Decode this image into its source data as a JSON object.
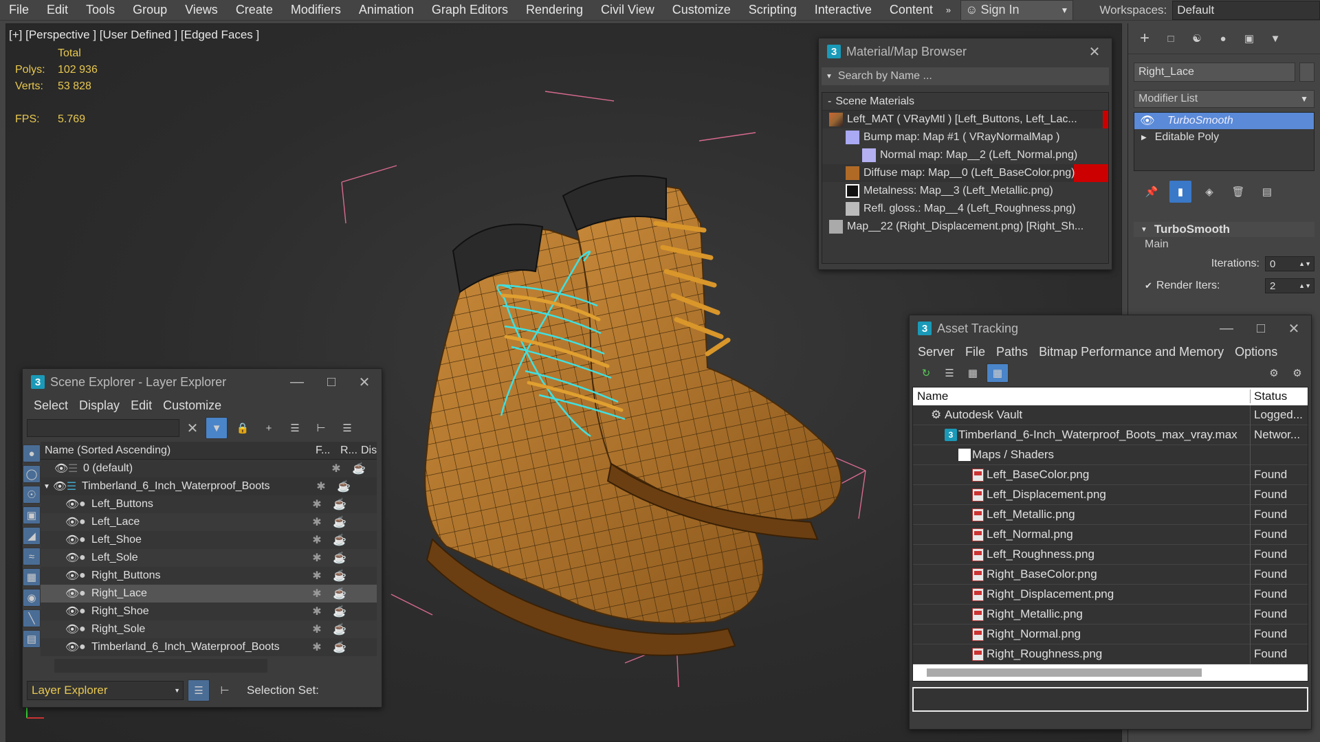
{
  "menu": [
    "File",
    "Edit",
    "Tools",
    "Group",
    "Views",
    "Create",
    "Modifiers",
    "Animation",
    "Graph Editors",
    "Rendering",
    "Civil View",
    "Customize",
    "Scripting",
    "Interactive",
    "Content"
  ],
  "signin": "Sign In",
  "workspaces_label": "Workspaces:",
  "workspace_value": "Default",
  "viewport": {
    "label": "[+] [Perspective ] [User Defined ] [Edged Faces ]",
    "total": "Total",
    "polys_label": "Polys:",
    "polys": "102 936",
    "verts_label": "Verts:",
    "verts": "53 828",
    "fps_label": "FPS:",
    "fps": "5.769"
  },
  "material_browser": {
    "title": "Material/Map Browser",
    "search_placeholder": "Search by Name ...",
    "section": "Scene Materials",
    "items": [
      "Left_MAT  ( VRayMtl )  [Left_Buttons, Left_Lac...",
      "Bump map: Map #1  ( VRayNormalMap )",
      "Normal map: Map__2 (Left_Normal.png)",
      "Diffuse map: Map__0 (Left_BaseColor.png)",
      "Metalness: Map__3 (Left_Metallic.png)",
      "Refl. gloss.: Map__4 (Left_Roughness.png)",
      "Map__22 (Right_Displacement.png)  [Right_Sh..."
    ]
  },
  "command_panel": {
    "object_name": "Right_Lace",
    "modifier_list": "Modifier List",
    "stack": [
      "TurboSmooth",
      "Editable Poly"
    ],
    "rollout": "TurboSmooth",
    "group": "Main",
    "iterations_label": "Iterations:",
    "iterations": "0",
    "render_iters_label": "Render Iters:",
    "render_iters": "2"
  },
  "scene_explorer": {
    "title": "Scene Explorer - Layer Explorer",
    "menu": [
      "Select",
      "Display",
      "Edit",
      "Customize"
    ],
    "col_name": "Name (Sorted Ascending)",
    "col_f": "F...",
    "col_r": "R...",
    "col_d": "Dis",
    "rows": [
      {
        "name": "0 (default)",
        "indent": 0
      },
      {
        "name": "Timberland_6_Inch_Waterproof_Boots",
        "indent": 0
      },
      {
        "name": "Left_Buttons",
        "indent": 1
      },
      {
        "name": "Left_Lace",
        "indent": 1
      },
      {
        "name": "Left_Shoe",
        "indent": 1
      },
      {
        "name": "Left_Sole",
        "indent": 1
      },
      {
        "name": "Right_Buttons",
        "indent": 1
      },
      {
        "name": "Right_Lace",
        "indent": 1
      },
      {
        "name": "Right_Shoe",
        "indent": 1
      },
      {
        "name": "Right_Sole",
        "indent": 1
      },
      {
        "name": "Timberland_6_Inch_Waterproof_Boots",
        "indent": 1
      }
    ],
    "footer_explorer": "Layer Explorer",
    "selection_set": "Selection Set:"
  },
  "asset_tracking": {
    "title": "Asset Tracking",
    "menu": [
      "Server",
      "File",
      "Paths",
      "Bitmap Performance and Memory",
      "Options"
    ],
    "col_name": "Name",
    "col_status": "Status",
    "rows": [
      {
        "name": "Autodesk Vault",
        "status": "Logged..."
      },
      {
        "name": "Timberland_6-Inch_Waterproof_Boots_max_vray.max",
        "status": "Networ..."
      },
      {
        "name": "Maps / Shaders",
        "status": ""
      },
      {
        "name": "Left_BaseColor.png",
        "status": "Found"
      },
      {
        "name": "Left_Displacement.png",
        "status": "Found"
      },
      {
        "name": "Left_Metallic.png",
        "status": "Found"
      },
      {
        "name": "Left_Normal.png",
        "status": "Found"
      },
      {
        "name": "Left_Roughness.png",
        "status": "Found"
      },
      {
        "name": "Right_BaseColor.png",
        "status": "Found"
      },
      {
        "name": "Right_Displacement.png",
        "status": "Found"
      },
      {
        "name": "Right_Metallic.png",
        "status": "Found"
      },
      {
        "name": "Right_Normal.png",
        "status": "Found"
      },
      {
        "name": "Right_Roughness.png",
        "status": "Found"
      }
    ]
  },
  "colors": {
    "accent": "#4a7fbf",
    "stats": "#e8c850",
    "selection_cyan": "#40e0e0",
    "leather": "#b87a2c"
  }
}
